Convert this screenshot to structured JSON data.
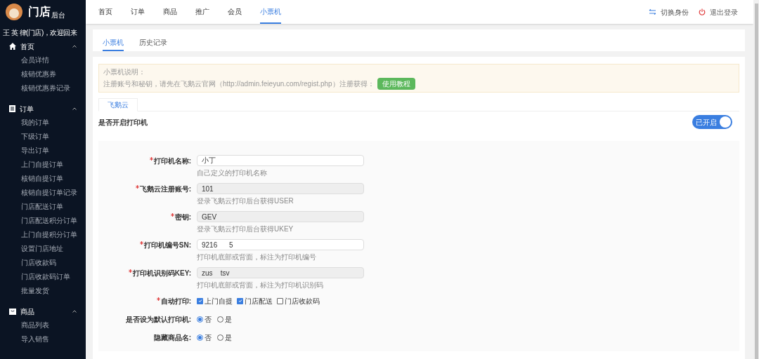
{
  "sidebar": {
    "brand": "门店",
    "brand_sub": "后台",
    "welcome": "王 英 律(门店)，欢迎回来",
    "groups": [
      {
        "kind": "home",
        "title": "首页",
        "expanded": true,
        "items": [
          "会员详情",
          "核销优惠券",
          "核销优惠券记录"
        ]
      },
      {
        "kind": "order",
        "title": "订单",
        "expanded": true,
        "items": [
          "我的订单",
          "下级订单",
          "导出订单",
          "上门自提订单",
          "核销自提订单",
          "核销自提订单记录",
          "门店配送订单",
          "门店配送积分订单",
          "上门自提积分订单",
          "设置门店地址",
          "门店收款码",
          "门店收款码订单",
          "批量发货"
        ]
      },
      {
        "kind": "goods",
        "title": "商品",
        "expanded": true,
        "items": [
          "商品列表",
          "导入销售"
        ]
      }
    ]
  },
  "topnav": [
    {
      "label": "首页",
      "selected": false
    },
    {
      "label": "订单",
      "selected": false
    },
    {
      "label": "商品",
      "selected": false
    },
    {
      "label": "推广",
      "selected": false
    },
    {
      "label": "会员",
      "selected": false
    },
    {
      "label": "小票机",
      "selected": true
    }
  ],
  "top_actions": [
    {
      "kind": "switch",
      "label": "切换身份"
    },
    {
      "kind": "logout",
      "label": "退出登录"
    }
  ],
  "tabs": [
    {
      "label": "小票机",
      "selected": true
    },
    {
      "label": "历史记录",
      "selected": false
    }
  ],
  "notice": {
    "title": "小票机说明：",
    "text": "注册账号和秘钥，请先在飞鹅云官网（http://admin.feieyun.com/regist.php）注册获得：",
    "button": "使用教程"
  },
  "provider_tabs": [
    {
      "label": "飞鹅云",
      "selected": true
    }
  ],
  "enable": {
    "label": "是否开启打印机",
    "on": true,
    "state_text": "已开启"
  },
  "form": [
    {
      "kind": "input",
      "label": "打印机名称:",
      "required": true,
      "value": "小丁",
      "disabled": false,
      "hint": "自己定义的打印机名称"
    },
    {
      "kind": "input",
      "label": "飞鹅云注册账号:",
      "required": true,
      "value": "101",
      "disabled": true,
      "hint": "登录飞鹅云打印后台获得USER"
    },
    {
      "kind": "input",
      "label": "密钥:",
      "required": true,
      "value": "GEV",
      "disabled": true,
      "hint": "登录飞鹅云打印后台获得UKEY"
    },
    {
      "kind": "input",
      "label": "打印机编号SN:",
      "required": true,
      "value": "9216      5",
      "disabled": false,
      "hint": "打印机底部或背面，标注为打印机编号"
    },
    {
      "kind": "input",
      "label": "打印机识别码KEY:",
      "required": true,
      "value": "zus    tsv",
      "disabled": true,
      "hint": "打印机底部或背面，标注为打印机识别码"
    },
    {
      "kind": "checkbox",
      "label": "自动打印:",
      "required": true,
      "options": [
        {
          "label": "上门自提",
          "checked": true
        },
        {
          "label": "门店配送",
          "checked": true
        },
        {
          "label": "门店收款码",
          "checked": false
        }
      ]
    },
    {
      "kind": "radio",
      "label": "是否设为默认打印机:",
      "required": false,
      "options": [
        {
          "label": "否",
          "selected": true
        },
        {
          "label": "是",
          "selected": false
        }
      ]
    },
    {
      "kind": "radio",
      "label": "隐藏商品名:",
      "required": false,
      "options": [
        {
          "label": "否",
          "selected": true
        },
        {
          "label": "是",
          "selected": false
        }
      ]
    }
  ]
}
